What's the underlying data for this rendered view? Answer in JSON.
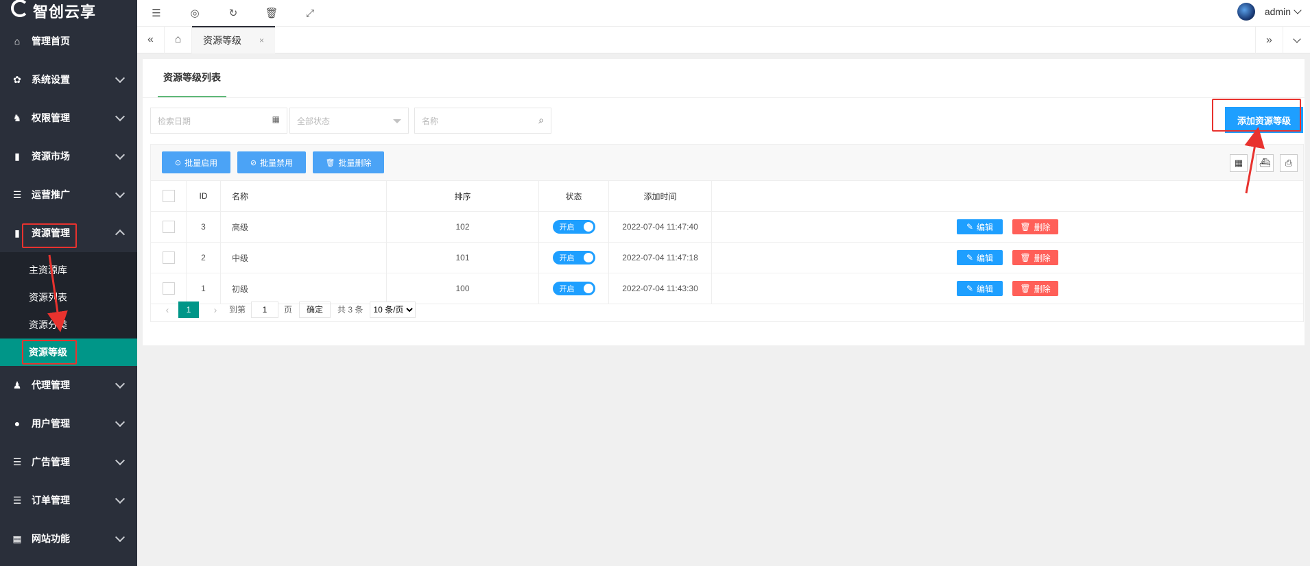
{
  "brand": {
    "name": "智创云享"
  },
  "sidebar": {
    "items": [
      {
        "label": "管理首页",
        "icon": "home-icon"
      },
      {
        "label": "系统设置",
        "icon": "gear-icon"
      },
      {
        "label": "权限管理",
        "icon": "permission-icon"
      },
      {
        "label": "资源市场",
        "icon": "book-icon"
      },
      {
        "label": "运营推广",
        "icon": "list-icon"
      },
      {
        "label": "资源管理",
        "icon": "book-icon"
      },
      {
        "label": "代理管理",
        "icon": "agent-icon"
      },
      {
        "label": "用户管理",
        "icon": "user-icon"
      },
      {
        "label": "广告管理",
        "icon": "list-icon"
      },
      {
        "label": "订单管理",
        "icon": "list-icon"
      },
      {
        "label": "网站功能",
        "icon": "grid-icon"
      }
    ],
    "sub_items": [
      {
        "label": "主资源库"
      },
      {
        "label": "资源列表"
      },
      {
        "label": "资源分类"
      },
      {
        "label": "资源等级"
      }
    ]
  },
  "header": {
    "username": "admin"
  },
  "tabs": {
    "current": "资源等级",
    "close": "×"
  },
  "card": {
    "tab_title": "资源等级列表",
    "filters": {
      "date_placeholder": "检索日期",
      "status_placeholder": "全部状态",
      "name_placeholder": "名称"
    },
    "add_button": "添加资源等级",
    "toolbar": {
      "enable": "批量启用",
      "disable": "批量禁用",
      "delete": "批量删除"
    },
    "table": {
      "headers": {
        "id": "ID",
        "name": "名称",
        "sort": "排序",
        "status": "状态",
        "time": "添加时间"
      },
      "rows": [
        {
          "id": "3",
          "name": "高级",
          "sort": "102",
          "status": "开启",
          "time": "2022-07-04 11:47:40"
        },
        {
          "id": "2",
          "name": "中级",
          "sort": "101",
          "status": "开启",
          "time": "2022-07-04 11:47:18"
        },
        {
          "id": "1",
          "name": "初级",
          "sort": "100",
          "status": "开启",
          "time": "2022-07-04 11:43:30"
        }
      ],
      "edit_label": "编辑",
      "delete_label": "删除"
    },
    "pager": {
      "current": "1",
      "goto_prefix": "到第",
      "goto_value": "1",
      "goto_suffix": "页",
      "confirm": "确定",
      "total": "共 3 条",
      "page_size": "10 条/页"
    }
  },
  "colors": {
    "sidebar_bg": "#2a2f3a",
    "active_green": "#009688",
    "primary_blue": "#1e9fff",
    "danger_red": "#ff5f58",
    "annotation_red": "#e8322e"
  }
}
